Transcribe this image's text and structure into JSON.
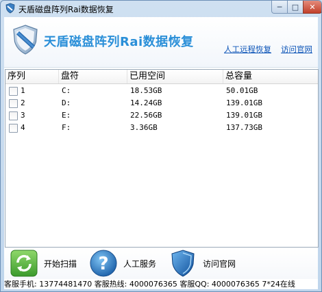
{
  "window": {
    "title": "天盾磁盘阵列Rai数据恢复",
    "min_icon": "minimize-icon",
    "max_icon": "maximize-icon",
    "close_icon": "close-icon"
  },
  "header": {
    "app_title": "天盾磁盘阵列Rai数据恢复",
    "link_remote": "人工远程恢复",
    "link_site": "访问官网",
    "logo_icon": "shield-logo-icon",
    "accent": "#2a8fd8"
  },
  "table": {
    "columns": [
      "序列",
      "盘符",
      "已用空间",
      "总容量"
    ],
    "rows": [
      {
        "index": "1",
        "drive": "C:",
        "used": "18.53GB",
        "total": "50.01GB",
        "checked": false
      },
      {
        "index": "2",
        "drive": "D:",
        "used": "14.24GB",
        "total": "139.01GB",
        "checked": false
      },
      {
        "index": "3",
        "drive": "E:",
        "used": "22.56GB",
        "total": "139.01GB",
        "checked": false
      },
      {
        "index": "4",
        "drive": "F:",
        "used": "3.36GB",
        "total": "137.73GB",
        "checked": false
      }
    ]
  },
  "actions": {
    "scan_label": "开始扫描",
    "service_label": "人工服务",
    "site_label": "访问官网",
    "scan_icon": "refresh-icon",
    "service_icon": "question-icon",
    "site_icon": "shield-icon"
  },
  "status": {
    "phone": "客服手机: 13774481470",
    "hotline": "客服热线: 4000076365",
    "qq": "客服QQ: 4000076365 7*24在线"
  }
}
